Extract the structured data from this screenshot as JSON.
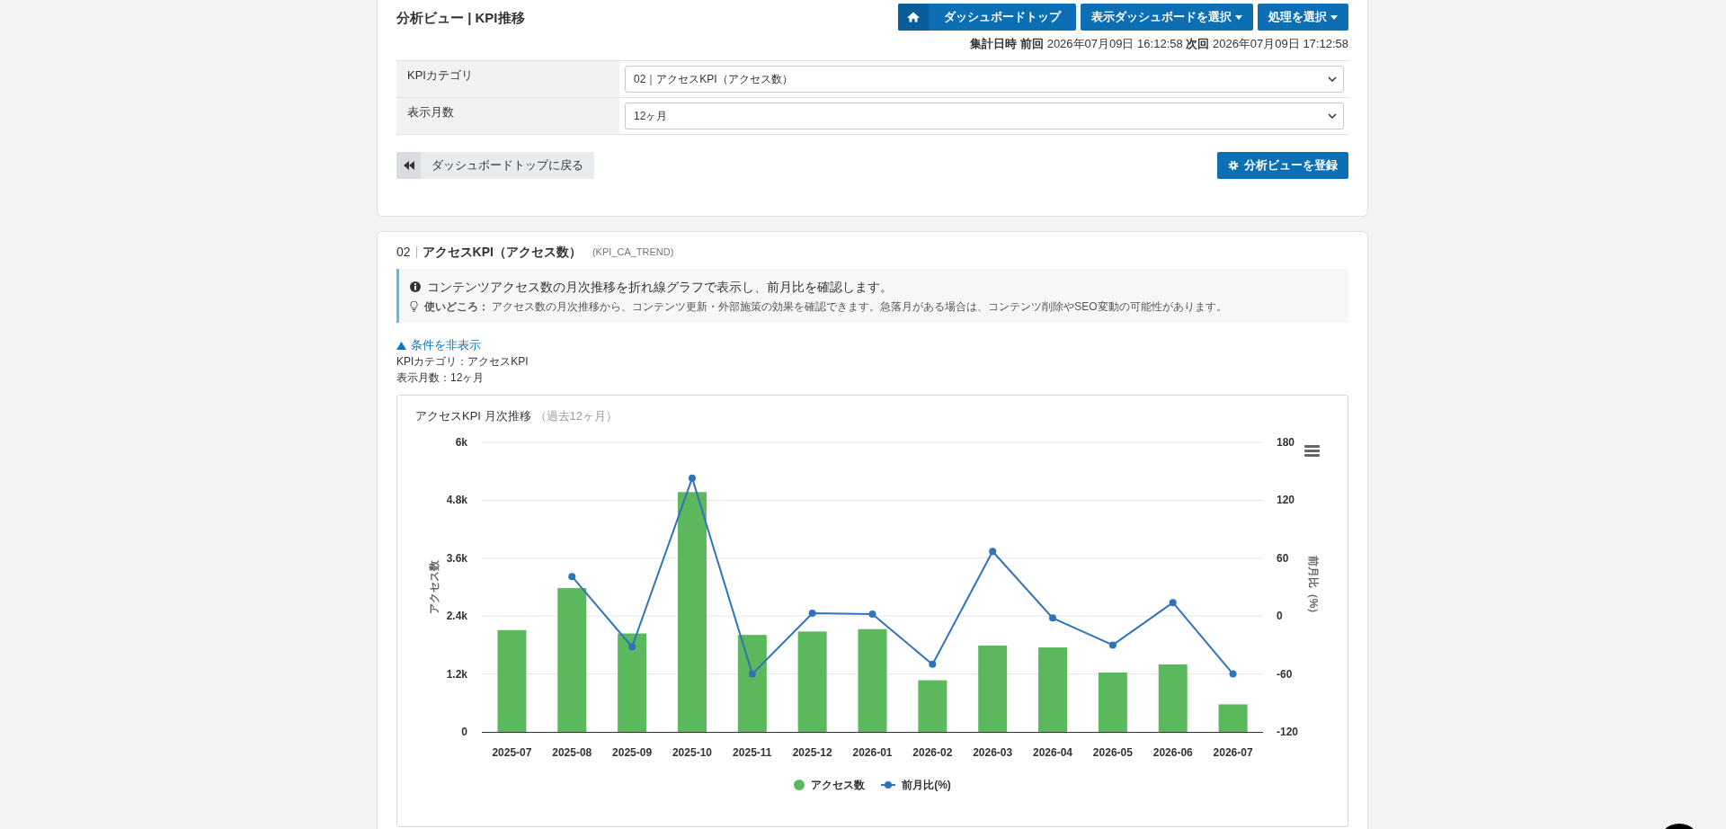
{
  "header": {
    "title": "分析ビュー | KPI推移",
    "buttons": [
      {
        "kind": "home",
        "label": "ダッシュボードトップ"
      },
      {
        "kind": "dropdown",
        "label": "表示ダッシュボードを選択"
      },
      {
        "kind": "dropdown",
        "label": "処理を選択"
      }
    ],
    "timestamp": "**集計日時** **前回** 2026年07月09日 16:12:58 **次回** 2026年07月09日 17:12:58"
  },
  "filters": [
    {
      "label": "KPIカテゴリ",
      "value": "02｜アクセスKPI（アクセス数）"
    },
    {
      "label": "表示月数",
      "value": "12ヶ月"
    }
  ],
  "actions": [
    {
      "kind": "back",
      "label": "ダッシュボードトップに戻る"
    },
    {
      "kind": "register",
      "label": "分析ビューを登録"
    }
  ],
  "section": {
    "number": "02",
    "title": "アクセスKPI（アクセス数）",
    "code": "(KPI_CA_TREND)",
    "info": {
      "description": "コンテンツアクセス数の月次推移を折れ線グラフで表示し、前月比を確認します。",
      "usage": "**使いどころ：** アクセス数の月次推移から、コンテンツ更新・外部施策の効果を確認できます。急落月がある場合は、コンテンツ削除やSEO変動の可能性があります。"
    },
    "toggle": {
      "label": "条件を非表示",
      "expanded": true
    },
    "conditions": [
      "KPIカテゴリ：アクセスKPI",
      "表示月数：12ヶ月"
    ],
    "chart": {
      "subtitle": "（過去12ヶ月）",
      "chart_data": {
        "type": "bar",
        "title": "アクセスKPI 月次推移",
        "ylabel": "アクセス数",
        "y2label": "前月比（%）",
        "grid": true,
        "legend": "bottom",
        "categories": [
          "2025-07",
          "2025-08",
          "2025-09",
          "2025-10",
          "2025-11",
          "2025-12",
          "2026-01",
          "2026-02",
          "2026-03",
          "2026-04",
          "2026-05",
          "2026-06",
          "2026-07"
        ],
        "ylim": [
          0,
          6000
        ],
        "yticks": [
          0,
          {
            "value": 1200,
            "label": "1.2k"
          },
          {
            "value": 2400,
            "label": "2.4k"
          },
          {
            "value": 3600,
            "label": "3.6k"
          },
          {
            "value": 4800,
            "label": "4.8k"
          },
          {
            "value": 6000,
            "label": "6k"
          }
        ],
        "y2lim": [
          -120,
          180
        ],
        "y2ticks": [
          -120,
          -60,
          0,
          60,
          120,
          180
        ],
        "series": [
          {
            "name": "アクセス数",
            "color": "#5cb85c",
            "values": [
              2110,
              2980,
              2040,
              4970,
              2010,
              2080,
              2130,
              1070,
              1790,
              1750,
              1230,
              1400,
              570
            ]
          },
          {
            "name": "前月比(%)",
            "type": "line",
            "axis": "y2",
            "marker": true,
            "color": "#2f74b8",
            "values": [
              null,
              41,
              -32,
              143,
              -60,
              3,
              2,
              -50,
              67,
              -2,
              -30,
              14,
              -60
            ]
          }
        ]
      }
    }
  }
}
